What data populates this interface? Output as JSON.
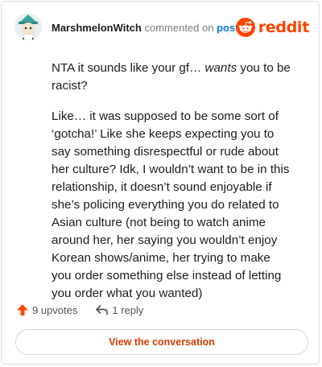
{
  "header": {
    "username": "MarshmelonWitch",
    "action_text": "commented on",
    "post_link": "post",
    "brand_word": "reddit"
  },
  "comment": {
    "paragraph1_before": "NTA it sounds like your gf… ",
    "paragraph1_emphasis": "wants",
    "paragraph1_after": " you to be racist?",
    "paragraph2": "Like… it was supposed to be some sort of ‘gotcha!’ Like she keeps expecting you to say something disrespectful or rude about her culture? Idk, I wouldn’t want to be in this relationship, it doesn’t sound enjoyable if she’s policing everything you do related to Asian culture (not being to watch anime around her, her saying you wouldn’t enjoy Korean shows/anime, her trying to make you order something else instead of letting you order what you wanted)"
  },
  "actions": {
    "upvotes_label": "9 upvotes",
    "replies_label": "1 reply"
  },
  "cta": {
    "label": "View the conversation"
  },
  "icons": {
    "upvote": "upvote-arrow-icon",
    "reply": "reply-arrow-icon",
    "brand": "reddit-snoo-icon",
    "avatar": "user-avatar-icon"
  },
  "colors": {
    "brand_orange": "#ff4500",
    "link_blue": "#0079d3",
    "cta_text": "#d93a00",
    "upvote_orange": "#ff4500"
  }
}
